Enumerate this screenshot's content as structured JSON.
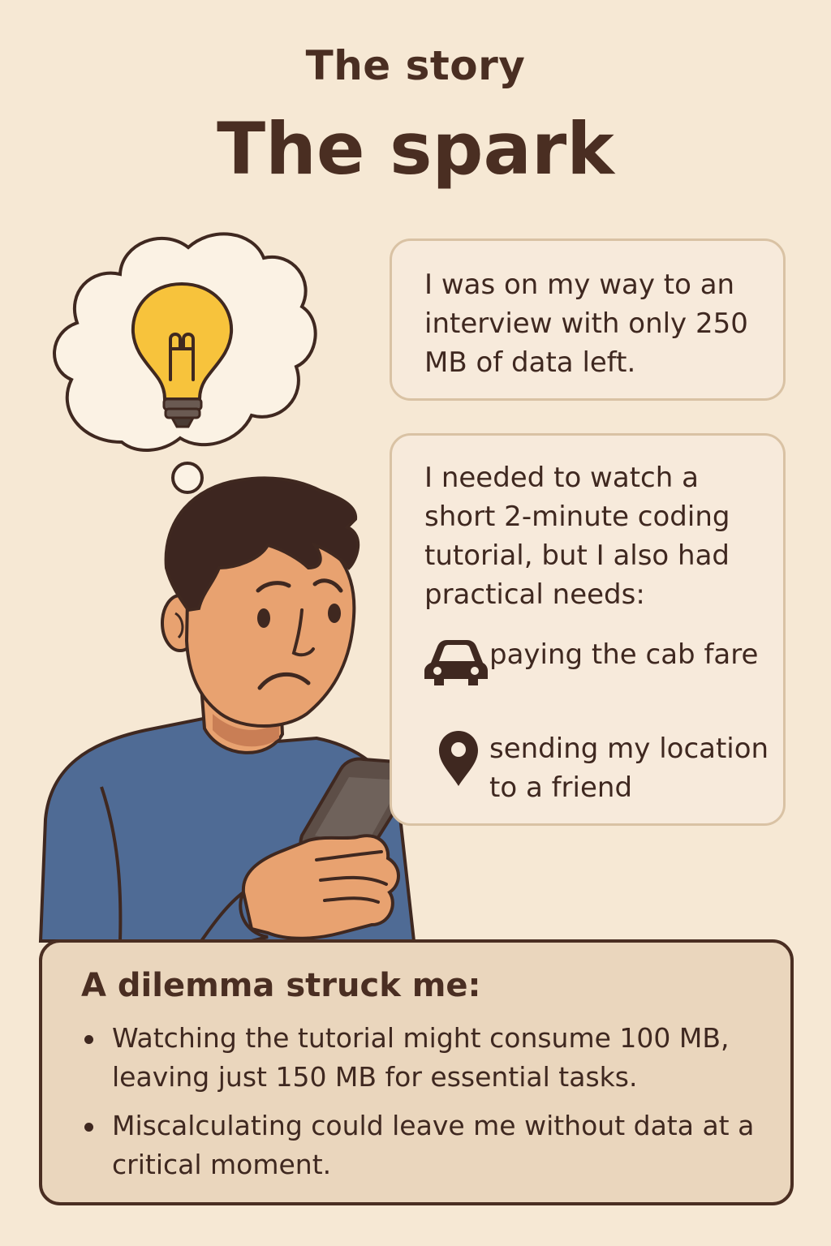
{
  "header": {
    "eyebrow": "The story",
    "title": "The spark"
  },
  "card1": {
    "text": "I was on my way to an interview with only 250 MB of data left."
  },
  "card2": {
    "text": "I needed to watch a short 2-minute coding tutorial, but I also had practical needs:",
    "needs": [
      {
        "icon": "car-icon",
        "label": "paying the cab fare"
      },
      {
        "icon": "location-pin-icon",
        "label": "sending my location to a friend"
      }
    ]
  },
  "dilemma": {
    "heading": "A dilemma struck me:",
    "bullets": [
      "Watching the tutorial might consume 100 MB, leaving just 150 MB for essential tasks.",
      "Miscalculating could leave me without data at a critical moment."
    ]
  },
  "illustration": {
    "thought_icon": "lightbulb-icon",
    "person": "worried-man-with-phone-illustration"
  },
  "colors": {
    "background": "#f6e8d4",
    "text": "#4a2e22",
    "card_border": "#d9c2a4",
    "dilemma_fill": "#ead6bd",
    "bulb": "#f7c33c",
    "shirt": "#4f6b95",
    "skin": "#e8a270"
  }
}
